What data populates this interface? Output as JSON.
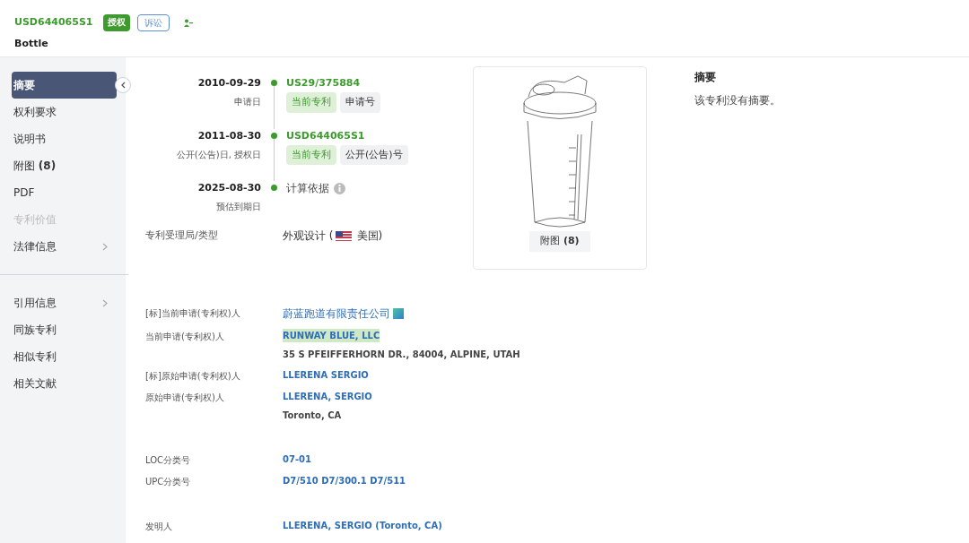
{
  "header": {
    "patent_number": "USD644065S1",
    "badges": [
      {
        "label": "授权",
        "kind": "solid"
      },
      {
        "label": "诉讼",
        "kind": "outline"
      }
    ],
    "title": "Bottle"
  },
  "sidebar": {
    "groups": [
      [
        {
          "label": "摘要",
          "selected": true,
          "disabled": false,
          "expandable": false
        },
        {
          "label": "权利要求",
          "selected": false,
          "disabled": false,
          "expandable": false
        },
        {
          "label": "说明书",
          "selected": false,
          "disabled": false,
          "expandable": false
        },
        {
          "label": "附图 **(8)**",
          "selected": false,
          "disabled": false,
          "expandable": false
        },
        {
          "label": "PDF",
          "selected": false,
          "disabled": false,
          "expandable": false
        },
        {
          "label": "专利价值",
          "selected": false,
          "disabled": true,
          "expandable": false
        },
        {
          "label": "法律信息",
          "selected": false,
          "disabled": false,
          "expandable": true
        }
      ],
      [
        {
          "label": "引用信息",
          "selected": false,
          "disabled": false,
          "expandable": true
        },
        {
          "label": "同族专利",
          "selected": false,
          "disabled": false,
          "expandable": false
        },
        {
          "label": "相似专利",
          "selected": false,
          "disabled": false,
          "expandable": false
        },
        {
          "label": "相关文献",
          "selected": false,
          "disabled": false,
          "expandable": false
        }
      ]
    ]
  },
  "timeline": [
    {
      "date": "2010-09-29",
      "label": "申请日",
      "kind": "number",
      "value": "US29/375884",
      "tags": [
        {
          "label": "当前专利",
          "kind": "current"
        },
        {
          "label": "申请号",
          "kind": "plain"
        }
      ]
    },
    {
      "date": "2011-08-30",
      "label": "公开(公告)日, 授权日",
      "kind": "number",
      "value": "USD644065S1",
      "tags": [
        {
          "label": "当前专利",
          "kind": "current"
        },
        {
          "label": "公开(公告)号",
          "kind": "plain"
        }
      ]
    },
    {
      "date": "2025-08-30",
      "label": "预估到期日",
      "kind": "basis",
      "value": "计算依据"
    }
  ],
  "office": {
    "label": "专利受理局/类型",
    "type": "外观设计 (",
    "country": "美国)"
  },
  "figure": {
    "caption": "附图 **(8)**"
  },
  "abstract": {
    "heading": "摘要",
    "text": "该专利没有摘要。"
  },
  "field_groups": [
    [
      {
        "label": "[标]当前申请(专利权)人",
        "value": "蔚蓝跑道有限责任公司",
        "highlighted": false,
        "logo": true
      },
      {
        "label": "当前申请(专利权)人",
        "value": "RUNWAY BLUE, LLC",
        "highlighted": true,
        "logo": false,
        "detail": "35 S PFEIFFERHORN DR., 84004, ALPINE, UTAH"
      },
      {
        "label": "[标]原始申请(专利权)人",
        "value": "LLERENA SERGIO",
        "highlighted": false,
        "logo": false
      },
      {
        "label": "原始申请(专利权)人",
        "value": "LLERENA, SERGIO",
        "highlighted": false,
        "logo": false,
        "detail": "Toronto, CA"
      }
    ],
    [
      {
        "label": "LOC分类号",
        "value": "07-01",
        "highlighted": false,
        "logo": false
      },
      {
        "label": "UPC分类号",
        "value": "D7/510   D7/300.1   D7/511",
        "highlighted": false,
        "logo": false
      }
    ],
    [
      {
        "label": "发明人",
        "value": "LLERENA, SERGIO (Toronto, CA)",
        "highlighted": false,
        "logo": false
      }
    ]
  ]
}
